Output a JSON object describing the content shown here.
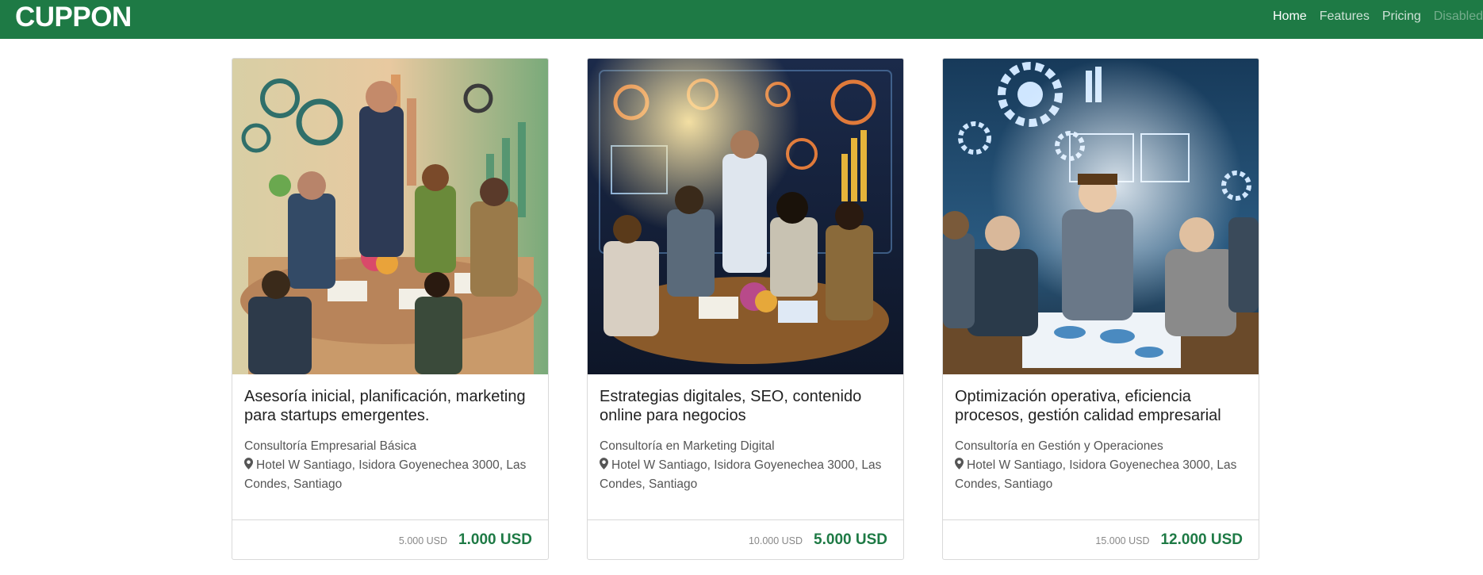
{
  "navbar": {
    "brand": "CUPPON",
    "links": [
      {
        "label": "Home",
        "state": "active"
      },
      {
        "label": "Features",
        "state": "normal"
      },
      {
        "label": "Pricing",
        "state": "normal"
      },
      {
        "label": "Disabled",
        "state": "disabled"
      }
    ]
  },
  "colors": {
    "brand_green": "#1e7a45",
    "price_green": "#1e7a45"
  },
  "cards": [
    {
      "title": "Asesoría inicial, planificación, marketing para startups emergentes.",
      "category": "Consultoría Empresarial Básica",
      "address": "Hotel W Santiago, Isidora Goyenechea 3000, Las Condes, Santiago",
      "old_price": "5.000 USD",
      "new_price": "1.000 USD",
      "image": "startup-meeting-illustration"
    },
    {
      "title": "Estrategias digitales, SEO, contenido online para negocios",
      "category": "Consultoría en Marketing Digital",
      "address": "Hotel W Santiago, Isidora Goyenechea 3000, Las Condes, Santiago",
      "old_price": "10.000 USD",
      "new_price": "5.000 USD",
      "image": "digital-marketing-meeting-illustration"
    },
    {
      "title": "Optimización operativa, eficiencia procesos, gestión calidad empresarial",
      "category": "Consultoría en Gestión y Operaciones",
      "address": "Hotel W Santiago, Isidora Goyenechea 3000, Las Condes, Santiago",
      "old_price": "15.000 USD",
      "new_price": "12.000 USD",
      "image": "operations-meeting-illustration"
    }
  ]
}
